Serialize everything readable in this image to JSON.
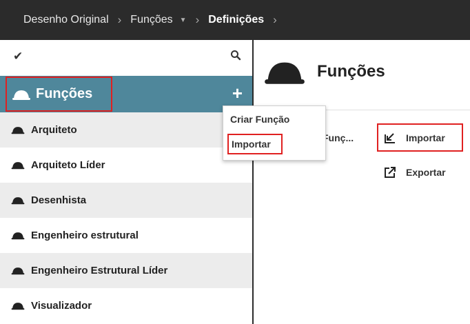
{
  "breadcrumb": {
    "items": [
      {
        "label": "Desenho Original"
      },
      {
        "label": "Funções"
      },
      {
        "label": "Definições"
      }
    ]
  },
  "sidebar": {
    "header_title": "Funções",
    "items": [
      {
        "label": "Arquiteto"
      },
      {
        "label": "Arquiteto Líder"
      },
      {
        "label": "Desenhista"
      },
      {
        "label": "Engenheiro estrutural"
      },
      {
        "label": "Engenheiro Estrutural Líder"
      },
      {
        "label": "Visualizador"
      }
    ]
  },
  "main": {
    "title": "Funções",
    "truncated_label": "Funç...",
    "actions": {
      "import_label": "Importar",
      "export_label": "Exportar"
    }
  },
  "dropdown": {
    "items": [
      {
        "label": "Criar Função"
      },
      {
        "label": "Importar"
      }
    ]
  },
  "icons": {
    "check": "checkmark-icon",
    "search": "search-icon",
    "plus": "plus-icon",
    "role": "hard-hat-icon",
    "import": "import-icon",
    "export": "export-icon",
    "caret": "caret-down-icon"
  },
  "colors": {
    "topbar": "#2b2b2b",
    "sidebar_header": "#4f879b",
    "highlight": "#e02020"
  }
}
